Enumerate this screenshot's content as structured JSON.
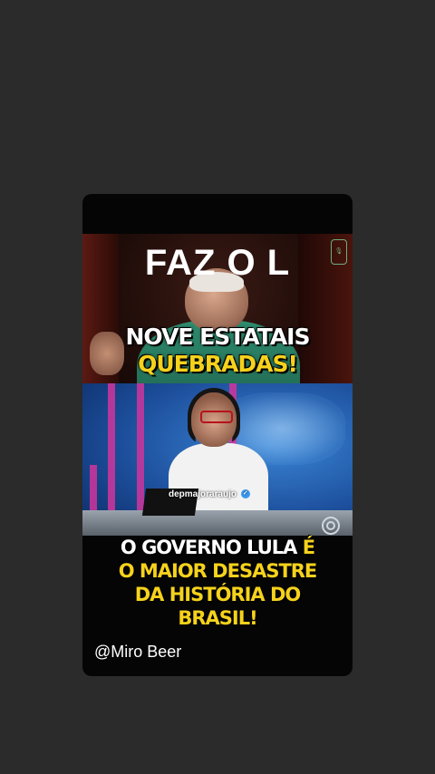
{
  "top_text": "FAZ O L",
  "headline_top": {
    "line1": "NOVE ESTATAIS",
    "line2": "QUEBRADAS!"
  },
  "overlay_username": "depmajoraraujo",
  "headline_bottom": {
    "line1_white": "O GOVERNO LULA ",
    "line1_yellow": "É",
    "line2": "O MAIOR DESASTRE",
    "line3": "DA HISTÓRIA DO",
    "line4": "BRASIL!"
  },
  "credit": "@Miro Beer",
  "colors": {
    "background": "#2b2b2b",
    "highlight_yellow": "#f5d21c",
    "white": "#ffffff"
  },
  "icons": [
    "microphone-logo-icon",
    "verified-badge-icon",
    "globo-logo-icon"
  ]
}
